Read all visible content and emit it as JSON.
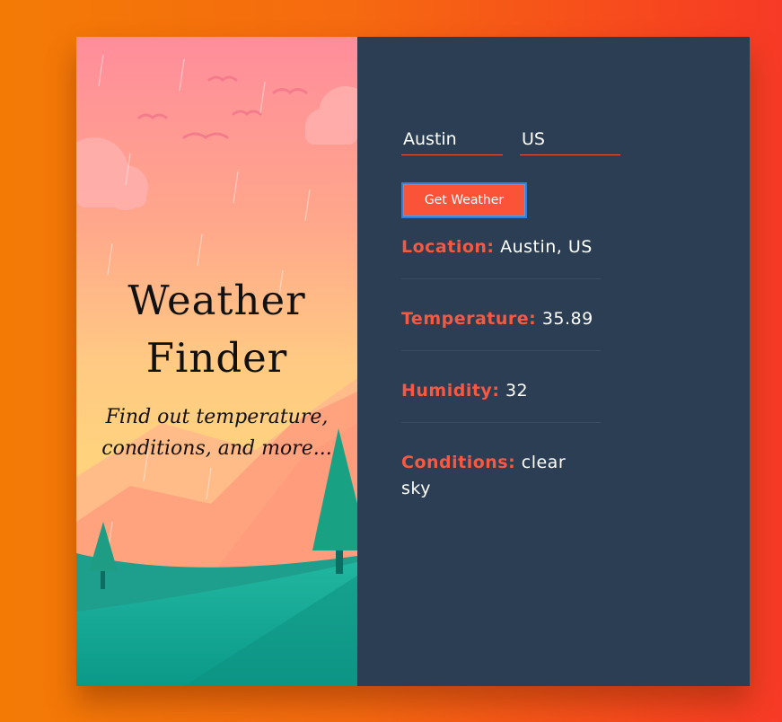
{
  "app": {
    "title": "Weather Finder",
    "title_line1": "Weather",
    "title_line2": "Finder",
    "tagline_line1": "Find out temperature,",
    "tagline_line2": "conditions, and more..."
  },
  "form": {
    "city_value": "Austin",
    "country_value": "US",
    "submit_label": "Get Weather"
  },
  "results": {
    "location_label": "Location:",
    "location_value": "Austin, US",
    "temperature_label": "Temperature:",
    "temperature_value": "35.89",
    "humidity_label": "Humidity:",
    "humidity_value": "32",
    "conditions_label": "Conditions:",
    "conditions_value": "clear sky"
  },
  "colors": {
    "background_start": "#f37b05",
    "background_end": "#f73a26",
    "panel": "#2b3e53",
    "accent": "#fb5338",
    "label": "#f55941",
    "focus_ring": "#3a7bd5"
  },
  "illustration": {
    "icons": [
      "cloud-icon",
      "bird-icon",
      "tree-icon",
      "mountain-icon",
      "rain-icon"
    ]
  }
}
